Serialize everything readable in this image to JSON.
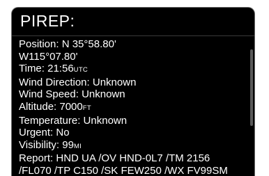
{
  "window": {
    "title": "PIREP:"
  },
  "report": {
    "position_label": "Position:",
    "position_lat": "N 35°58.80'",
    "position_lon": "W115°07.80'",
    "time_label": "Time:",
    "time_value": "21:56",
    "time_unit": "UTC",
    "wind_direction_label": "Wind Direction:",
    "wind_direction_value": "Unknown",
    "wind_speed_label": "Wind Speed:",
    "wind_speed_value": "Unknown",
    "altitude_label": "Altitude:",
    "altitude_value": "7000",
    "altitude_unit": "FT",
    "temperature_label": "Temperature:",
    "temperature_value": "Unknown",
    "urgent_label": "Urgent:",
    "urgent_value": "No",
    "visibility_label": "Visibility:",
    "visibility_value": "99",
    "visibility_unit": "MI",
    "report_label": "Report:",
    "report_line1": "HND UA /OV HND-0L7 /TM 2156",
    "report_line2": "/FL070 /TP C150 /SK FEW250 /WX FV99SM"
  }
}
